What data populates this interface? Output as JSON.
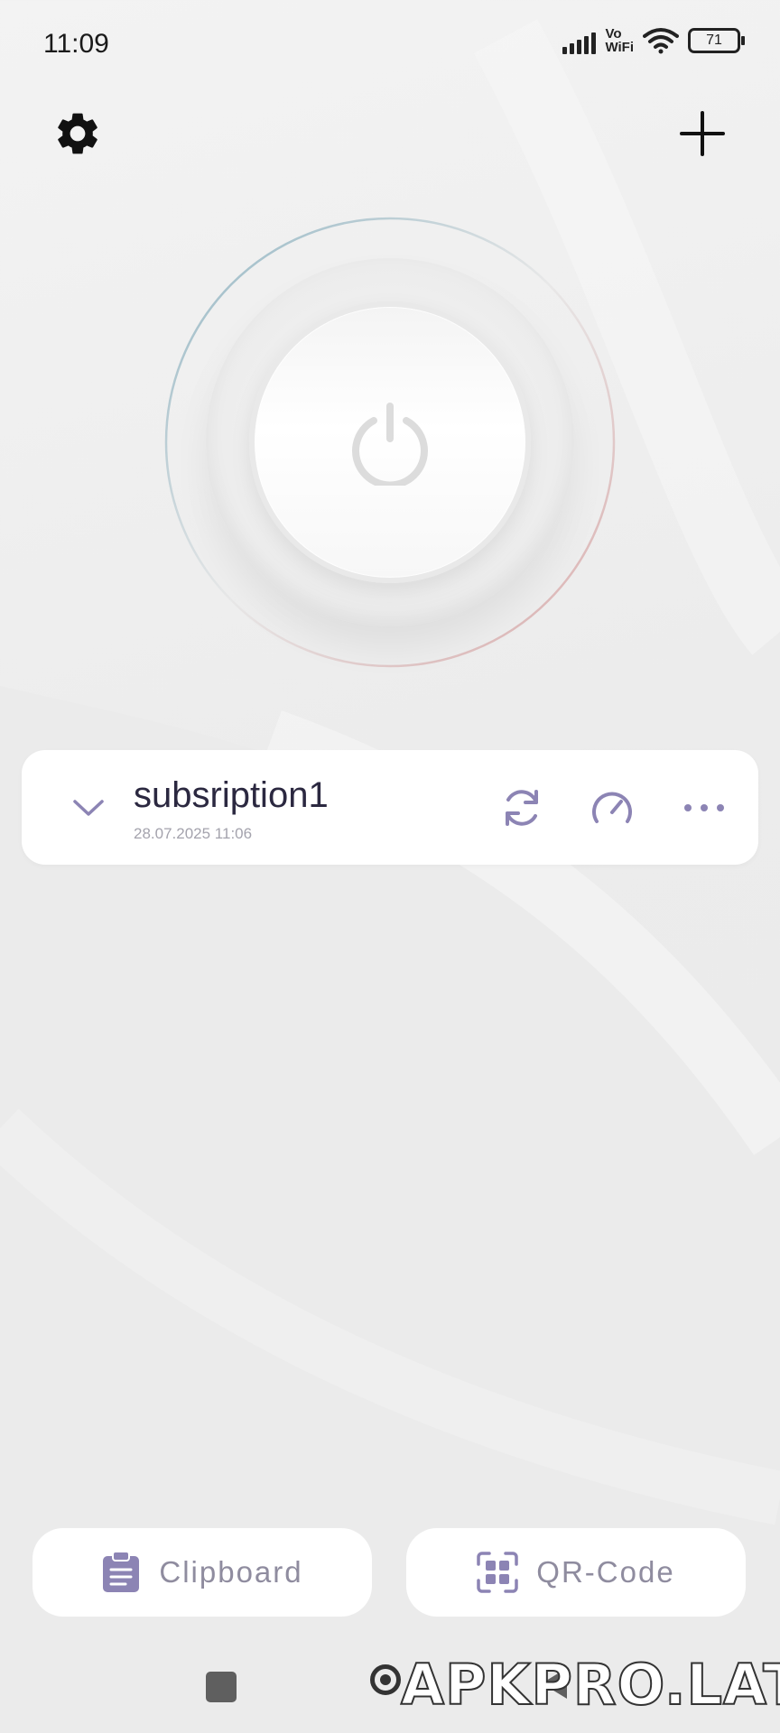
{
  "status_bar": {
    "time": "11:09",
    "network_label_top": "Vo",
    "network_label_bottom": "WiFi",
    "battery": "71",
    "icons": [
      "signal-icon",
      "wifi-icon",
      "battery-icon"
    ]
  },
  "toolbar": {
    "settings_icon": "gear-icon",
    "add_icon": "plus-icon"
  },
  "power": {
    "icon": "power-icon"
  },
  "subscription": {
    "name": "subsription1",
    "date": "28.07.2025 11:06",
    "icons": [
      "chevron-down-icon",
      "refresh-icon",
      "speedometer-icon",
      "more-icon"
    ]
  },
  "actions": {
    "clipboard_label": "Clipboard",
    "qr_label": "QR-Code"
  },
  "watermark": "APKPRO.LAT",
  "colors": {
    "accent": "#8c84b4",
    "text_primary": "#2b2840",
    "text_muted": "#a4a3ad",
    "card_bg": "#ffffff",
    "ring_left": "#8fb4c2",
    "ring_right": "#d9a8a8"
  }
}
